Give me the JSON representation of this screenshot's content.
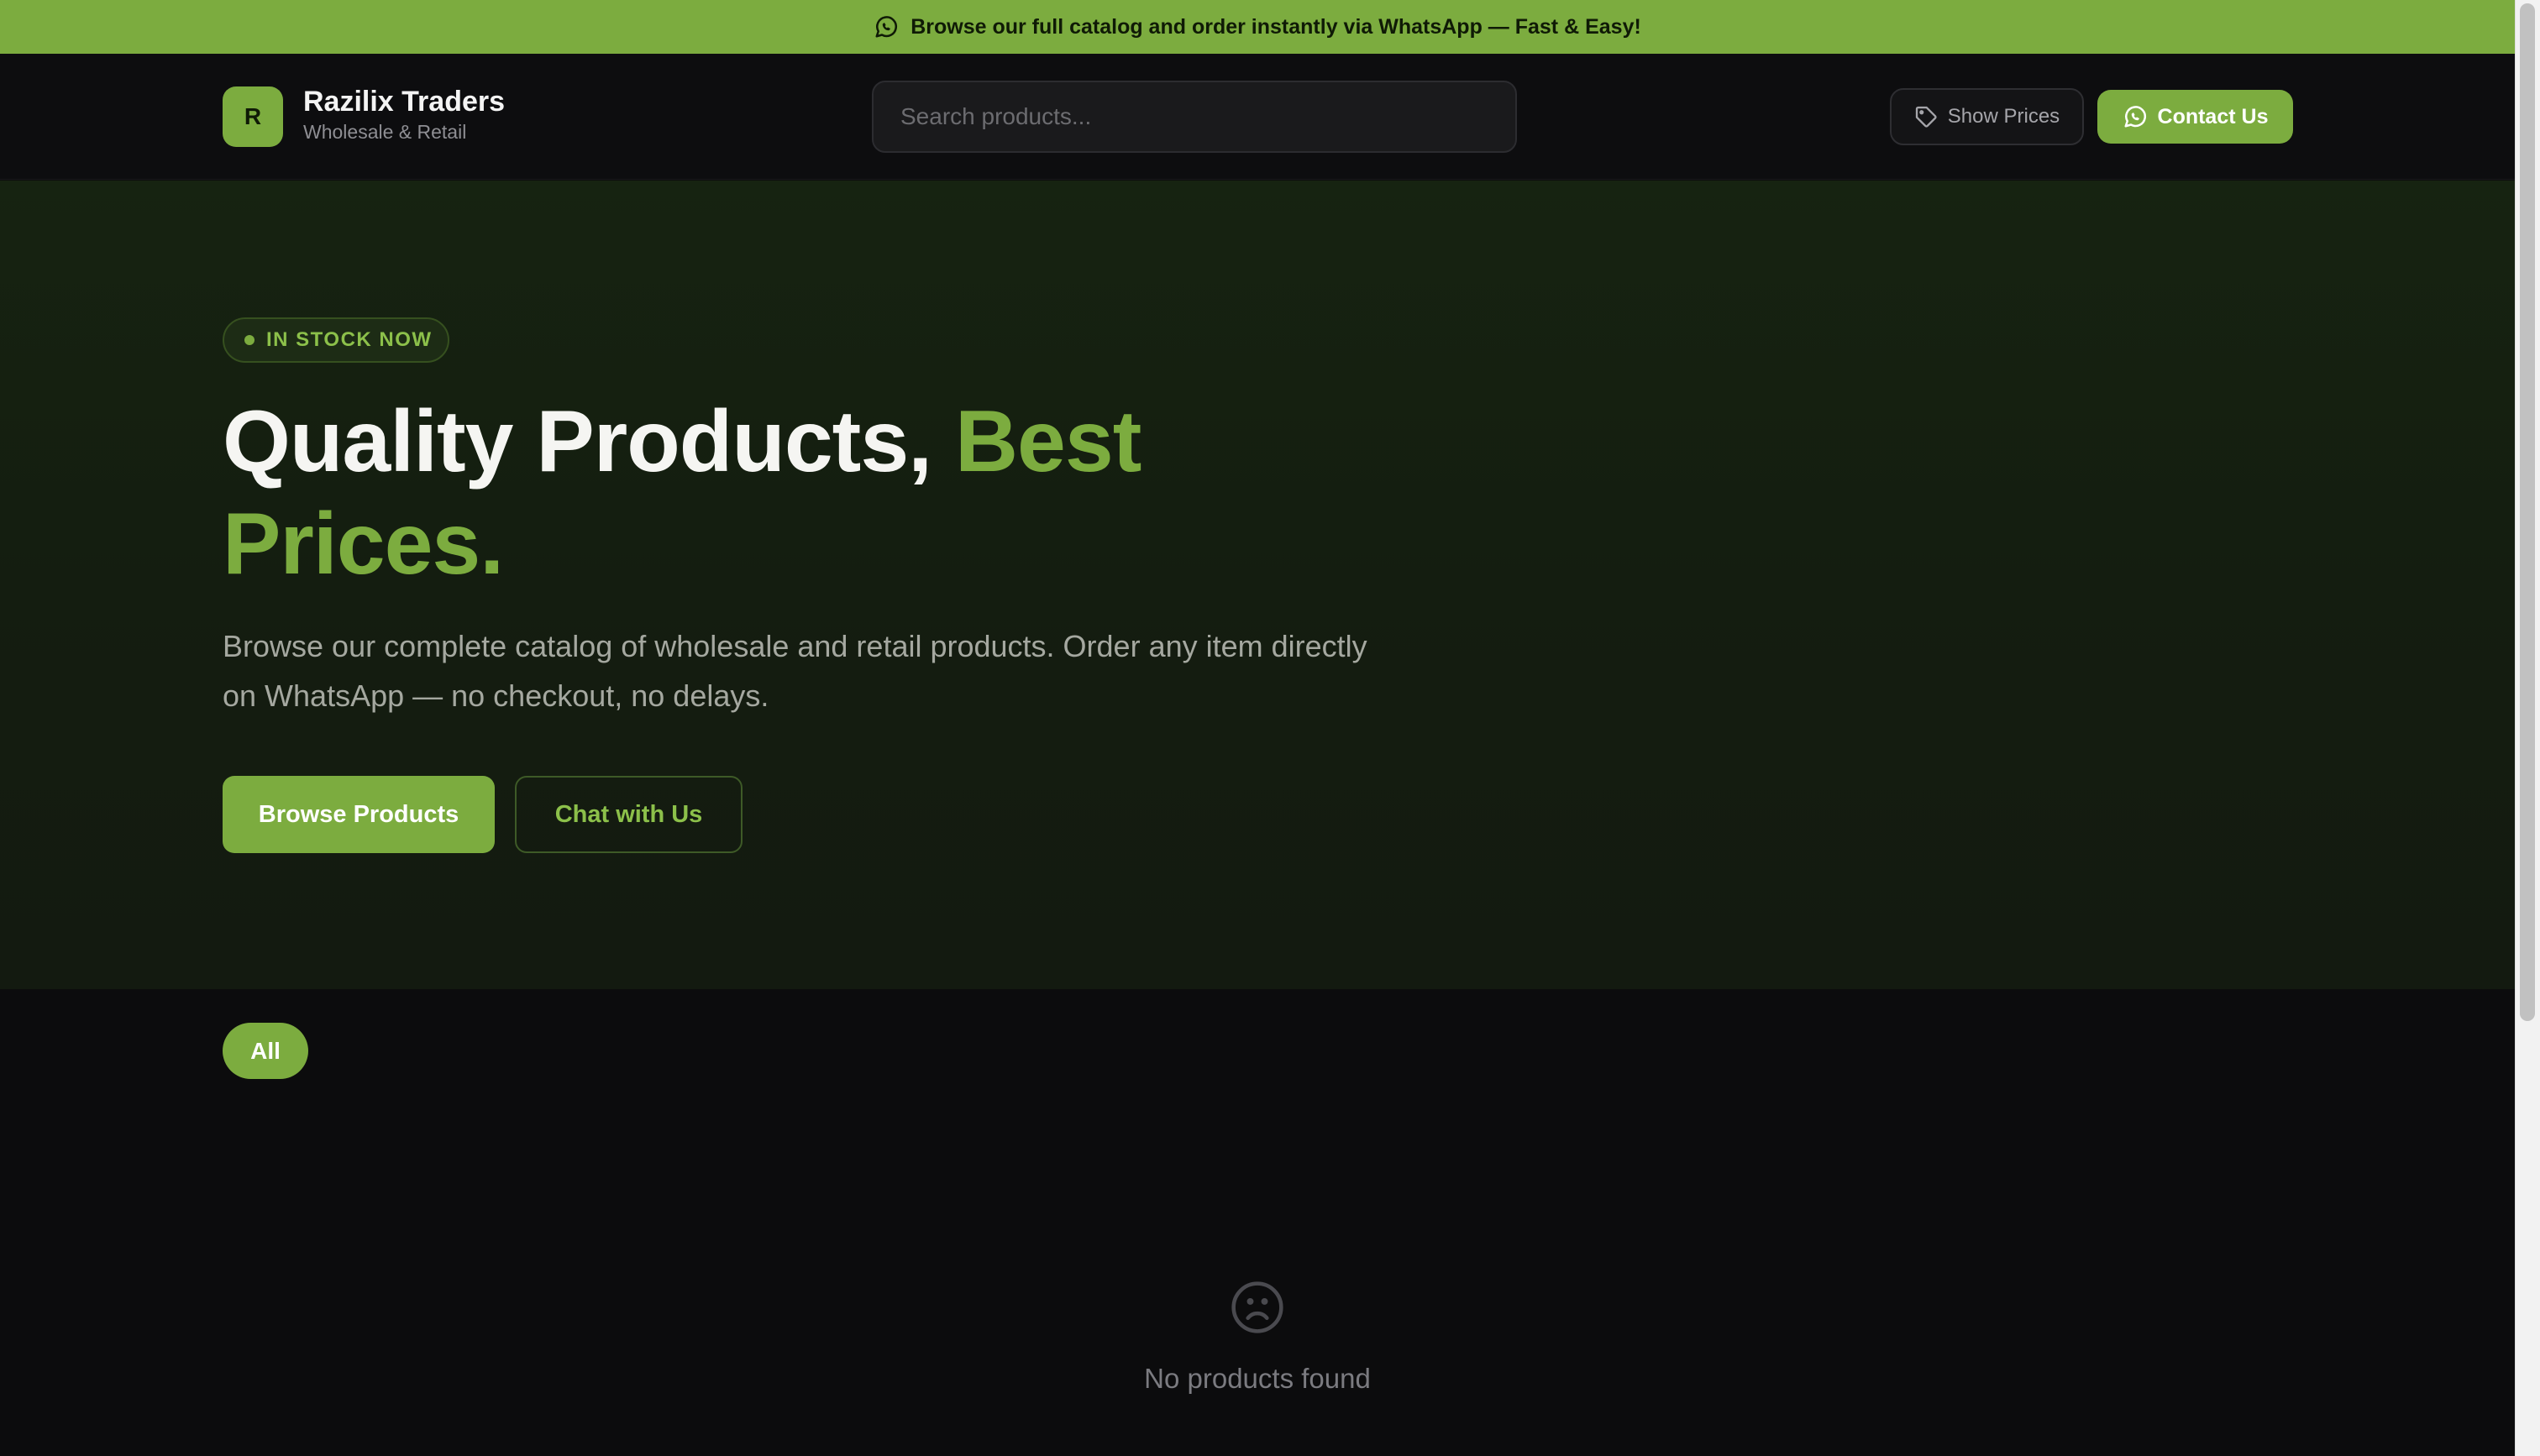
{
  "announcement": {
    "icon": "whatsapp-icon",
    "text": "Browse our full catalog and order instantly via WhatsApp — Fast & Easy!"
  },
  "header": {
    "logo_letter": "R",
    "brand_name": "Razilix Traders",
    "brand_tagline": "Wholesale & Retail",
    "search_placeholder": "Search products...",
    "search_value": "",
    "show_prices_label": "Show Prices",
    "show_prices_icon": "tag-icon",
    "contact_label": "Contact Us",
    "contact_icon": "whatsapp-icon"
  },
  "hero": {
    "badge": "IN STOCK NOW",
    "title_main": "Quality Products, ",
    "title_accent": "Best Prices.",
    "description": "Browse our complete catalog of wholesale and retail products. Order any item directly on WhatsApp — no checkout, no delays.",
    "browse_label": "Browse Products",
    "chat_label": "Chat with Us"
  },
  "categories": {
    "items": [
      {
        "label": "All",
        "active": true
      }
    ]
  },
  "empty_state": {
    "icon": "sad-face-icon",
    "message": "No products found"
  },
  "colors": {
    "accent": "#7cac3f",
    "background": "#0c0c0d",
    "hero_background": "#152010"
  }
}
